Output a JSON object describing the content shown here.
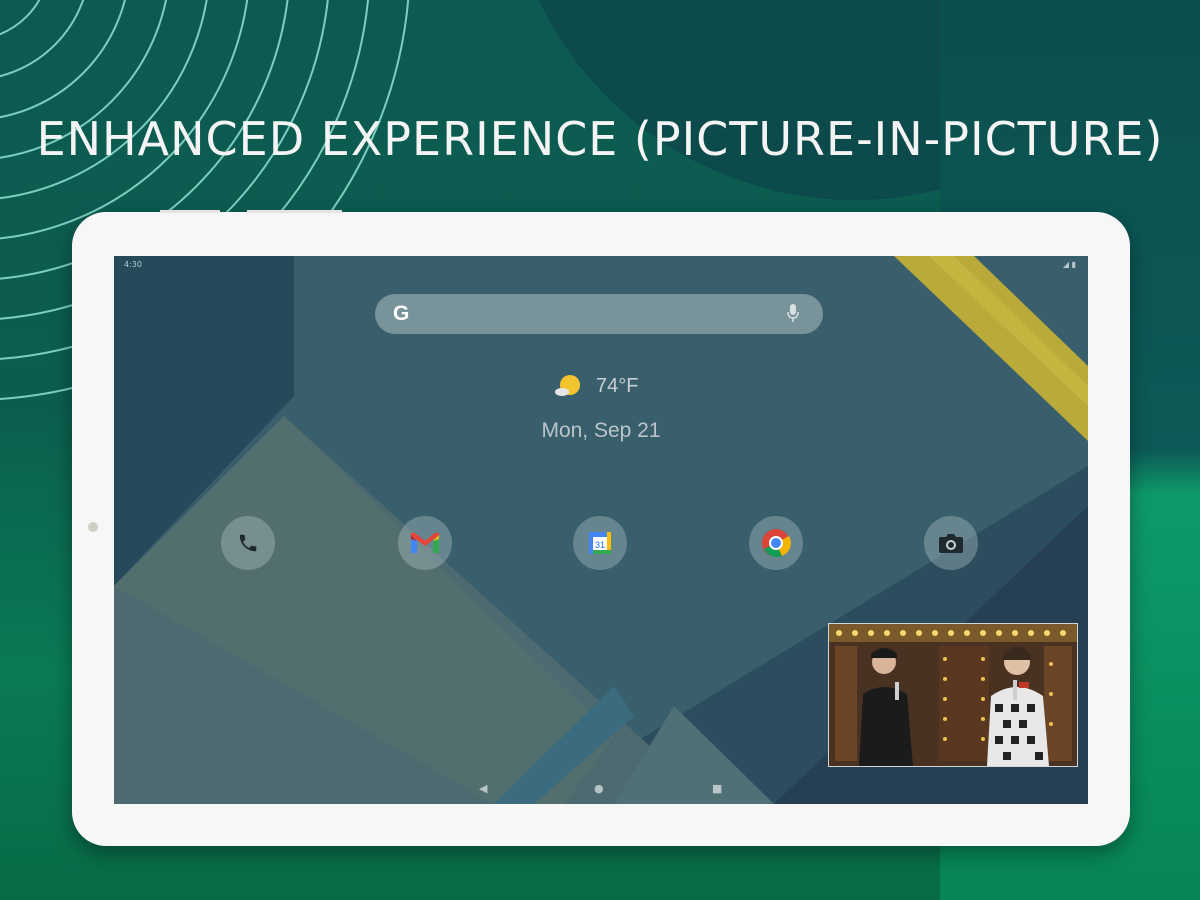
{
  "headline": "ENHANCED EXPERIENCE (PICTURE-IN-PICTURE)",
  "tablet": {
    "status": {
      "time": "4:30",
      "signal": "◢ ▮"
    },
    "search": {
      "logo": "G",
      "mic_icon": "mic-icon"
    },
    "weather": {
      "icon": "partly-sunny-icon",
      "temperature": "74°F"
    },
    "date": "Mon, Sep 21",
    "apps": [
      {
        "name": "Phone",
        "icon": "phone-icon"
      },
      {
        "name": "Gmail",
        "icon": "gmail-icon"
      },
      {
        "name": "Calendar",
        "icon": "calendar-icon",
        "day": "31"
      },
      {
        "name": "Chrome",
        "icon": "chrome-icon"
      },
      {
        "name": "Camera",
        "icon": "camera-icon"
      }
    ],
    "navbar": {
      "back": "◀",
      "home": "●",
      "recents": "■"
    },
    "pip": {
      "content": "video-stage-performance"
    }
  },
  "colors": {
    "background": "#0b5e4f",
    "accent_arcs": "#8fe3d4",
    "tablet_frame": "#f7f7f7",
    "wallpaper": "#2f5062"
  }
}
